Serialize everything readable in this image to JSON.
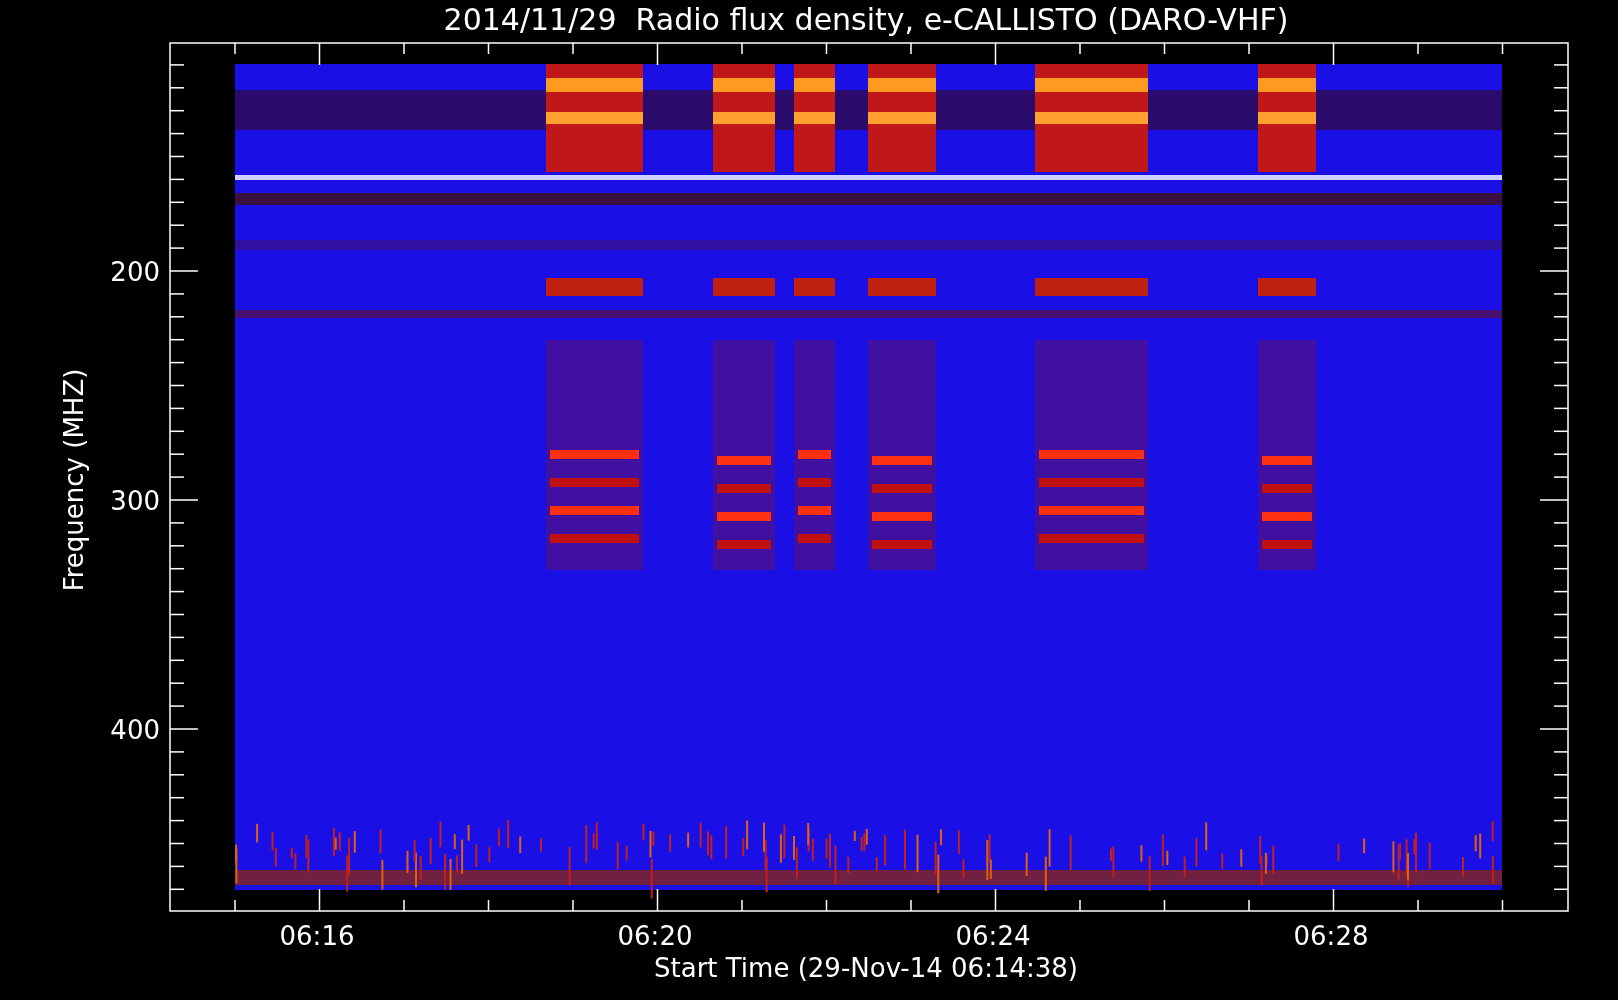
{
  "chart": {
    "title": "2014/11/29  Radio flux density, e-CALLISTO (DARO-VHF)",
    "ylabel": "Frequency (MHZ)",
    "xlabel": "Start Time (29-Nov-14 06:14:38)",
    "yticks": [
      "200",
      "300",
      "400"
    ],
    "xticks": [
      "06:16",
      "06:20",
      "06:24",
      "06:28"
    ]
  }
}
